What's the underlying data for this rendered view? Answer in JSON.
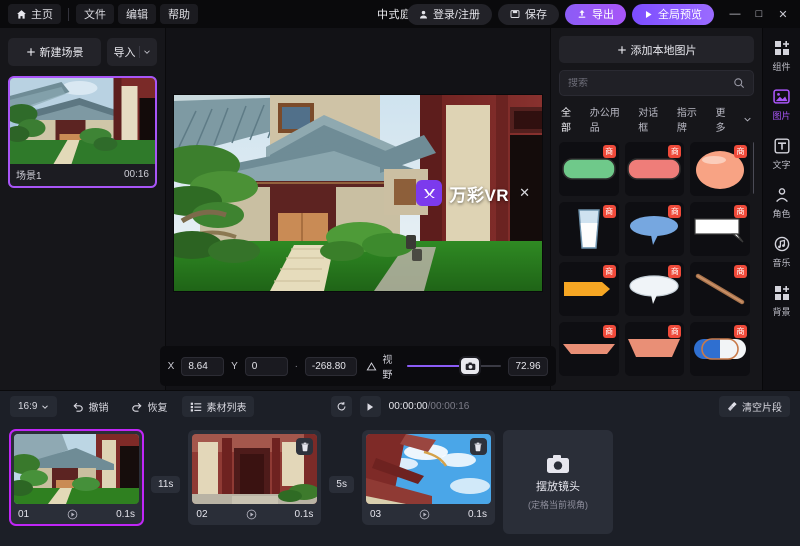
{
  "titlebar": {
    "home": "主页",
    "menus": [
      "文件",
      "编辑",
      "帮助"
    ],
    "title": "中式庭院",
    "login": "登录/注册",
    "save": "保存",
    "export": "导出",
    "preview_all": "全局预览",
    "minimize": "—",
    "maximize": "□",
    "close": "✕"
  },
  "scenes": {
    "new_scene": "新建场景",
    "import": "导入",
    "list": [
      {
        "name": "场景1",
        "duration": "00:16"
      }
    ]
  },
  "preview": {
    "watermark_text": "万彩VR",
    "watermark_close": "✕",
    "controls": {
      "x_label": "X",
      "x_value": "8.64",
      "y_label": "Y",
      "y_value": "0",
      "dot": "·",
      "z_value": "-268.80",
      "fov_label": "视野",
      "fov_value": "72.96"
    }
  },
  "assets": {
    "add_local_image": "添加本地图片",
    "search_placeholder": "搜索",
    "categories": [
      "全部",
      "办公用品",
      "对话框",
      "指示牌"
    ],
    "more": "更多",
    "items": [
      {
        "badge": "商",
        "shape": "green-rounded-bar"
      },
      {
        "badge": "商",
        "shape": "red-rounded-bar"
      },
      {
        "badge": "商",
        "shape": "peach-blob"
      },
      {
        "badge": "商",
        "shape": "milk-glass"
      },
      {
        "badge": "商",
        "shape": "blue-speech-ellipse"
      },
      {
        "badge": "商",
        "shape": "white-speech-rect"
      },
      {
        "badge": "商",
        "shape": "orange-speech-tag"
      },
      {
        "badge": "商",
        "shape": "white-speech-ellipse"
      },
      {
        "badge": "商",
        "shape": "brown-stick"
      },
      {
        "badge": "商",
        "shape": "salmon-thin-banner"
      },
      {
        "badge": "商",
        "shape": "salmon-thick-banner"
      },
      {
        "badge": "商",
        "shape": "blue-white-capsule"
      }
    ]
  },
  "rail": [
    {
      "label": "组件",
      "icon": "components-icon",
      "active": false
    },
    {
      "label": "图片",
      "icon": "image-icon",
      "active": true
    },
    {
      "label": "文字",
      "icon": "text-icon",
      "active": false
    },
    {
      "label": "角色",
      "icon": "character-icon",
      "active": false
    },
    {
      "label": "音乐",
      "icon": "music-icon",
      "active": false
    },
    {
      "label": "背景",
      "icon": "background-icon",
      "active": false
    }
  ],
  "timeline": {
    "ratio": "16:9",
    "undo": "撤销",
    "redo": "恢复",
    "material_list": "素材列表",
    "current_time": "00:00:00",
    "total_time": "/00:00:16",
    "clear_clips": "清空片段",
    "clips": [
      {
        "index": "01",
        "duration": "0.1s",
        "selected": true,
        "gap_after": "11s"
      },
      {
        "index": "02",
        "duration": "0.1s",
        "selected": false,
        "gap_after": "5s"
      },
      {
        "index": "03",
        "duration": "0.1s",
        "selected": false,
        "gap_after": ""
      }
    ],
    "add_clip": {
      "title": "摆放镜头",
      "subtitle": "(定格当前视角)"
    }
  },
  "colors": {
    "accent": "#a855f7",
    "accent2": "#c026f7",
    "badge": "#ef4a3a",
    "panel": "#16161a",
    "timeline": "#1c1f27"
  }
}
